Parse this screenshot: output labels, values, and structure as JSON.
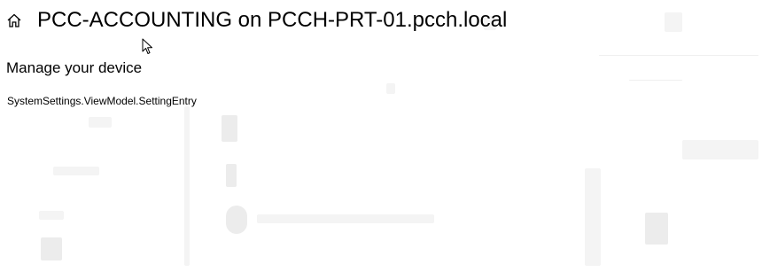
{
  "header": {
    "title": "PCC-ACCOUNTING on PCCH-PRT-01.pcch.local",
    "home_icon": "home-icon"
  },
  "main": {
    "section_heading": "Manage your device",
    "setting_entry": "SystemSettings.ViewModel.SettingEntry"
  },
  "colors": {
    "background": "#ffffff",
    "text": "#000000"
  }
}
